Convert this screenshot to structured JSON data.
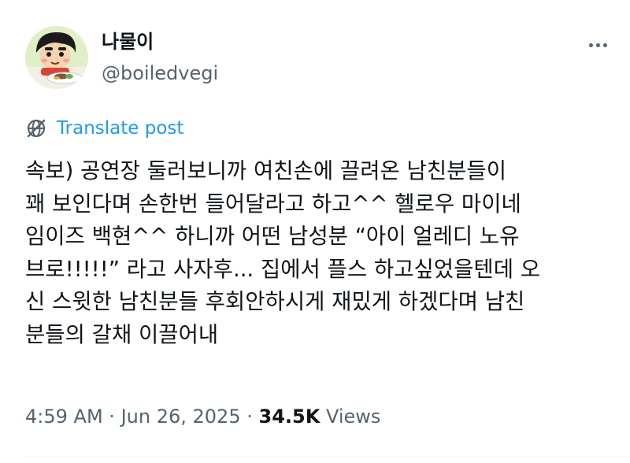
{
  "author": {
    "display_name": "나물이",
    "handle": "@boiledvegi",
    "avatar_icon": "cartoon-character-avatar"
  },
  "more_icon": "more-horizontal-icon",
  "translate": {
    "label": "Translate post",
    "icon": "translate-globe-icon"
  },
  "post": {
    "lines": [
      "속보) 공연장 둘러보니까 여친손에 끌려온 남친분들이",
      "꽤 보인다며 손한번 들어달라고 하고^^ 헬로우 마이네",
      "임이즈 백현^^ 하니까 어떤 남성분 “아이 얼레디 노유",
      "브로!!!!!” 라고 사자후... 집에서 플스 하고싶었을텐데 오",
      "신 스윗한 남친분들 후회안하시게 재밌게 하겠다며 남친",
      "분들의 갈채 이끌어내"
    ]
  },
  "meta": {
    "time": "4:59 AM",
    "date": "Jun 26, 2025",
    "separator": "·",
    "views_count": "34.5K",
    "views_label": "Views"
  },
  "colors": {
    "text_primary": "#0f1419",
    "text_secondary": "#536471",
    "link_blue": "#1d9bf0"
  }
}
